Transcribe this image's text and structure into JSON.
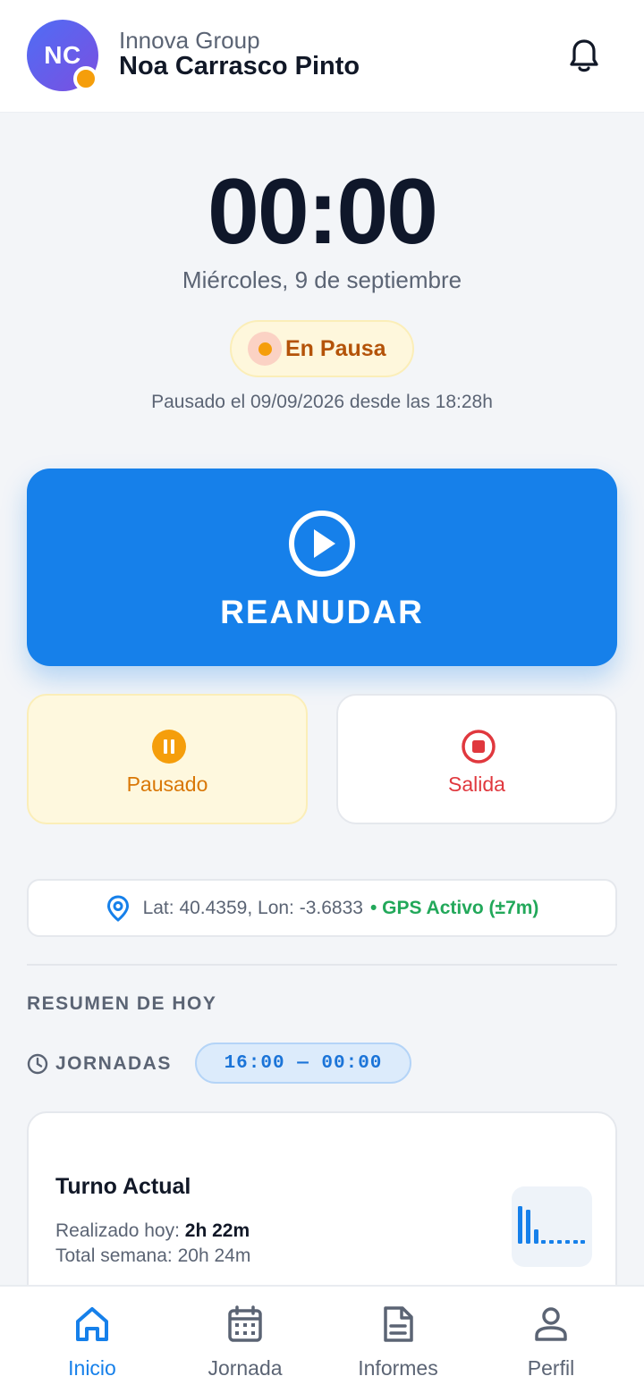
{
  "header": {
    "avatar_initials": "NC",
    "company": "Innova Group",
    "username": "Noa Carrasco Pinto"
  },
  "clock": {
    "time": "00:00",
    "date": "Miércoles, 9 de septiembre"
  },
  "status": {
    "label": "En Pausa",
    "info": "Pausado el 09/09/2026 desde las 18:28h"
  },
  "actions": {
    "resume_label": "REANUDAR",
    "paused_label": "Pausado",
    "exit_label": "Salida"
  },
  "gps": {
    "coords": "Lat: 40.4359, Lon: -3.6833",
    "status": "• GPS Activo (±7m)"
  },
  "summary": {
    "title": "RESUMEN DE HOY",
    "jornadas_label": "JORNADAS",
    "range": "16:00 — 00:00"
  },
  "shift": {
    "title": "Turno Actual",
    "done_label": "Realizado hoy:",
    "done_value": "2h 22m",
    "week_label": "Total semana:",
    "week_value": "20h 24m"
  },
  "nav": {
    "items": [
      {
        "label": "Inicio",
        "icon": "home-icon",
        "active": true
      },
      {
        "label": "Jornada",
        "icon": "calendar-icon",
        "active": false
      },
      {
        "label": "Informes",
        "icon": "document-icon",
        "active": false
      },
      {
        "label": "Perfil",
        "icon": "user-icon",
        "active": false
      }
    ]
  },
  "colors": {
    "primary": "#1680ea",
    "paused": "#f59e0b",
    "exit": "#e0383e",
    "gps_active": "#22a85a"
  }
}
